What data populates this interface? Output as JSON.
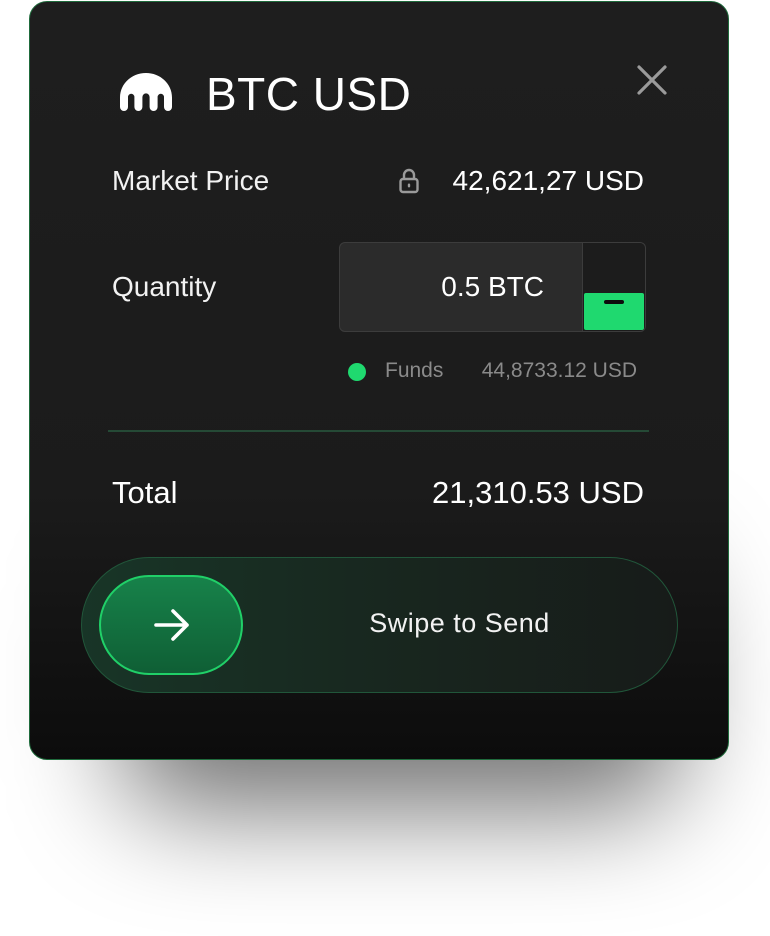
{
  "header": {
    "title": "BTC USD",
    "logo_icon": "kraken-logo-icon",
    "close_icon": "close-icon"
  },
  "market": {
    "label": "Market Price",
    "value": "42,621,27 USD",
    "lock_icon": "lock-icon"
  },
  "quantity": {
    "label": "Quantity",
    "value": "0.5 BTC",
    "stepper_icon": "minus-icon"
  },
  "funds": {
    "label": "Funds",
    "value": "44,8733.12 USD"
  },
  "total": {
    "label": "Total",
    "value": "21,310.53 USD"
  },
  "swipe": {
    "label": "Swipe to Send",
    "handle_icon": "arrow-right-icon"
  },
  "colors": {
    "accent": "#1fd96f",
    "card_background": "#1c1c1c",
    "card_border": "#1f6b3c",
    "muted_text": "#8a8a8a"
  }
}
